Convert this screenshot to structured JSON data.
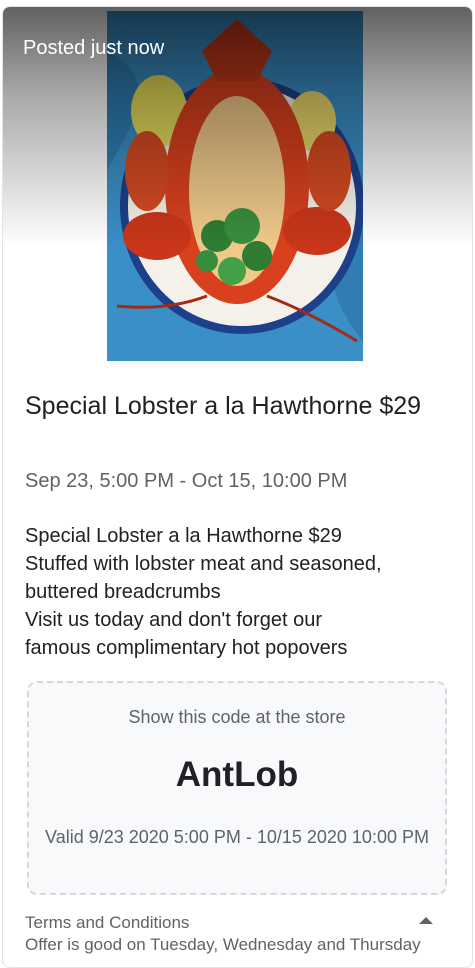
{
  "post": {
    "posted_label": "Posted just now",
    "image_alt": "Lobster dish",
    "title": "Special Lobster a la Hawthorne $29",
    "date_range": "Sep 23, 5:00 PM - Oct 15, 10:00 PM",
    "description_lines": [
      "Special Lobster a la Hawthorne $29",
      "Stuffed with lobster meat and seasoned,",
      "buttered breadcrumbs",
      "Visit us today and don't forget our",
      "famous complimentary hot popovers"
    ]
  },
  "coupon": {
    "hint": "Show this code at the store",
    "code": "AntLob",
    "validity": "Valid 9/23 2020 5:00 PM - 10/15 2020 10:00 PM"
  },
  "terms": {
    "label": "Terms and Conditions",
    "text": "Offer is good on Tuesday, Wednesday and Thursday",
    "toggle_icon": "caret-up-icon"
  },
  "colors": {
    "photo_background": "#3a8fc6",
    "plate_rim": "#1e3f8a",
    "lobster": "#d9411e",
    "parsley": "#2e7d32"
  }
}
